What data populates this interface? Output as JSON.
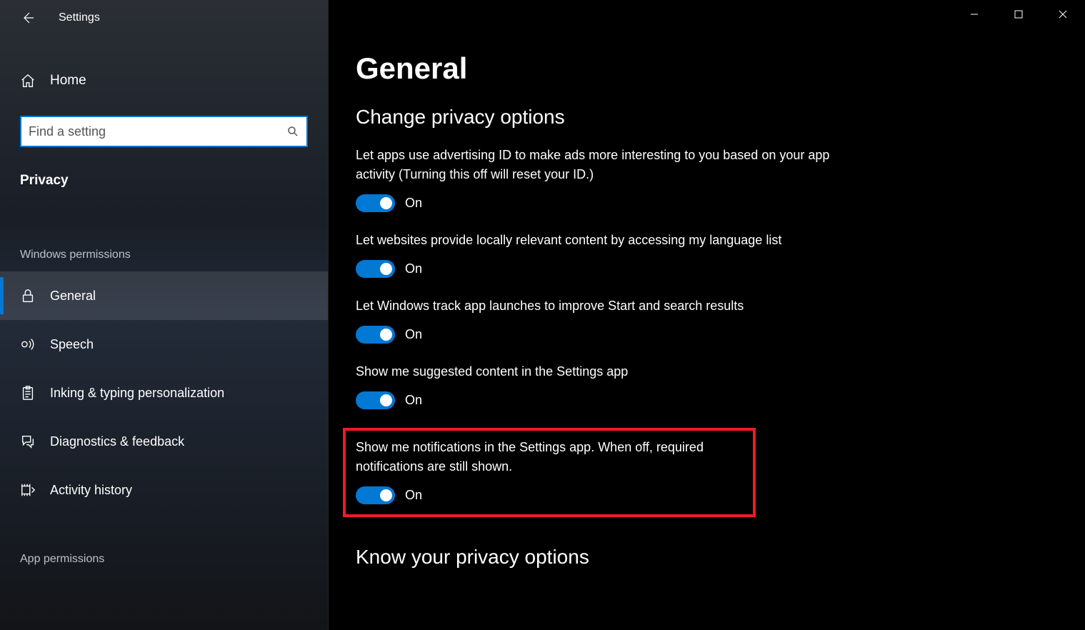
{
  "titlebar": {
    "title": "Settings"
  },
  "sidebar": {
    "home_label": "Home",
    "search_placeholder": "Find a setting",
    "category_label": "Privacy",
    "section1_header": "Windows permissions",
    "nav": [
      {
        "id": "general",
        "label": "General",
        "icon": "lock-icon",
        "selected": true
      },
      {
        "id": "speech",
        "label": "Speech",
        "icon": "speech-icon",
        "selected": false
      },
      {
        "id": "inking",
        "label": "Inking & typing personalization",
        "icon": "clipboard-icon",
        "selected": false
      },
      {
        "id": "diagnostics",
        "label": "Diagnostics & feedback",
        "icon": "feedback-icon",
        "selected": false
      },
      {
        "id": "activity",
        "label": "Activity history",
        "icon": "activity-icon",
        "selected": false
      }
    ],
    "section2_header": "App permissions"
  },
  "content": {
    "page_title": "General",
    "subhead": "Change privacy options",
    "settings": [
      {
        "desc": "Let apps use advertising ID to make ads more interesting to you based on your app activity (Turning this off will reset your ID.)",
        "state": "On"
      },
      {
        "desc": "Let websites provide locally relevant content by accessing my language list",
        "state": "On"
      },
      {
        "desc": "Let Windows track app launches to improve Start and search results",
        "state": "On"
      },
      {
        "desc": "Show me suggested content in the Settings app",
        "state": "On"
      },
      {
        "desc": "Show me notifications in the Settings app. When off, required notifications are still shown.",
        "state": "On",
        "highlighted": true
      }
    ],
    "subhead2": "Know your privacy options"
  }
}
